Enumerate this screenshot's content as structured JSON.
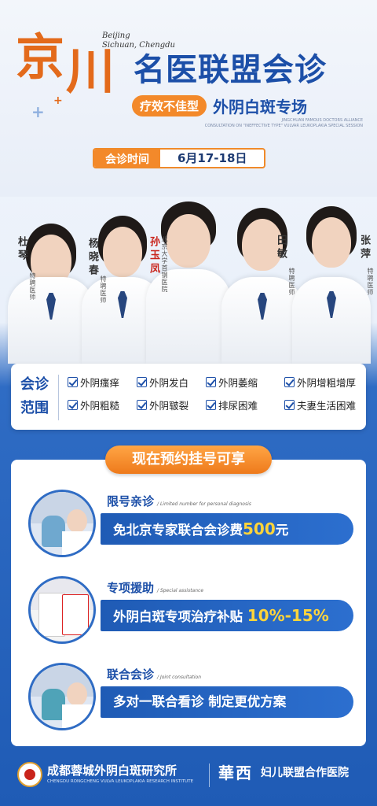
{
  "header": {
    "calligraphy": [
      "京",
      "川"
    ],
    "city_en": [
      "Beijing",
      "Sichuan, Chengdu"
    ],
    "title": "名医联盟会诊",
    "tag": "疗效不佳型",
    "subtitle": "外阴白斑专场",
    "subtitle_en": [
      "JINGCHUAN FAMOUS DOCTORS ALLIANCE",
      "CONSULTATION ON \"INEFFECTIVE TYPE\" VULVAR LEUKOPLAKIA SPECIAL SESSION"
    ],
    "time_label": "会诊时间",
    "time_value": "6月17-18日"
  },
  "doctors": [
    {
      "name": "杜琴",
      "title": "特聘医师"
    },
    {
      "name": "杨晓春",
      "title": "特聘医师"
    },
    {
      "name": "孙玉凤",
      "title": "北京大学首钢医院"
    },
    {
      "name": "田敏",
      "title": "特聘医师"
    },
    {
      "name": "张萍",
      "title": "特聘医师"
    }
  ],
  "scope": {
    "label": [
      "会诊",
      "范围"
    ],
    "items": [
      "外阴瘙痒",
      "外阴发白",
      "外阴萎缩",
      "外阴增粗增厚",
      "外阴粗糙",
      "外阴皲裂",
      "排尿困难",
      "夫妻生活困难"
    ]
  },
  "offers": {
    "banner": "现在预约挂号可享",
    "items": [
      {
        "title": "限号亲诊",
        "en": "/ Limited number for personal diagnosis",
        "text": "免北京专家联合会诊费",
        "highlight": "500",
        "suffix": "元"
      },
      {
        "title": "专项援助",
        "en": "/ Special assistance",
        "text": "外阴白斑专项治疗补贴 ",
        "highlight": "10%-15%",
        "suffix": ""
      },
      {
        "title": "联合会诊",
        "en": "/ Joint consultation",
        "text": "多对一联合看诊 制定更优方案",
        "highlight": "",
        "suffix": ""
      }
    ]
  },
  "footer": {
    "name": "成都蓉城外阴白斑研究所",
    "name_en": "CHENGDU RONGCHENG VULVA LEUKOPLAKIA RESEARCH INSTITUTE",
    "partner_logo": "華西",
    "partner": "妇儿联盟合作医院"
  }
}
